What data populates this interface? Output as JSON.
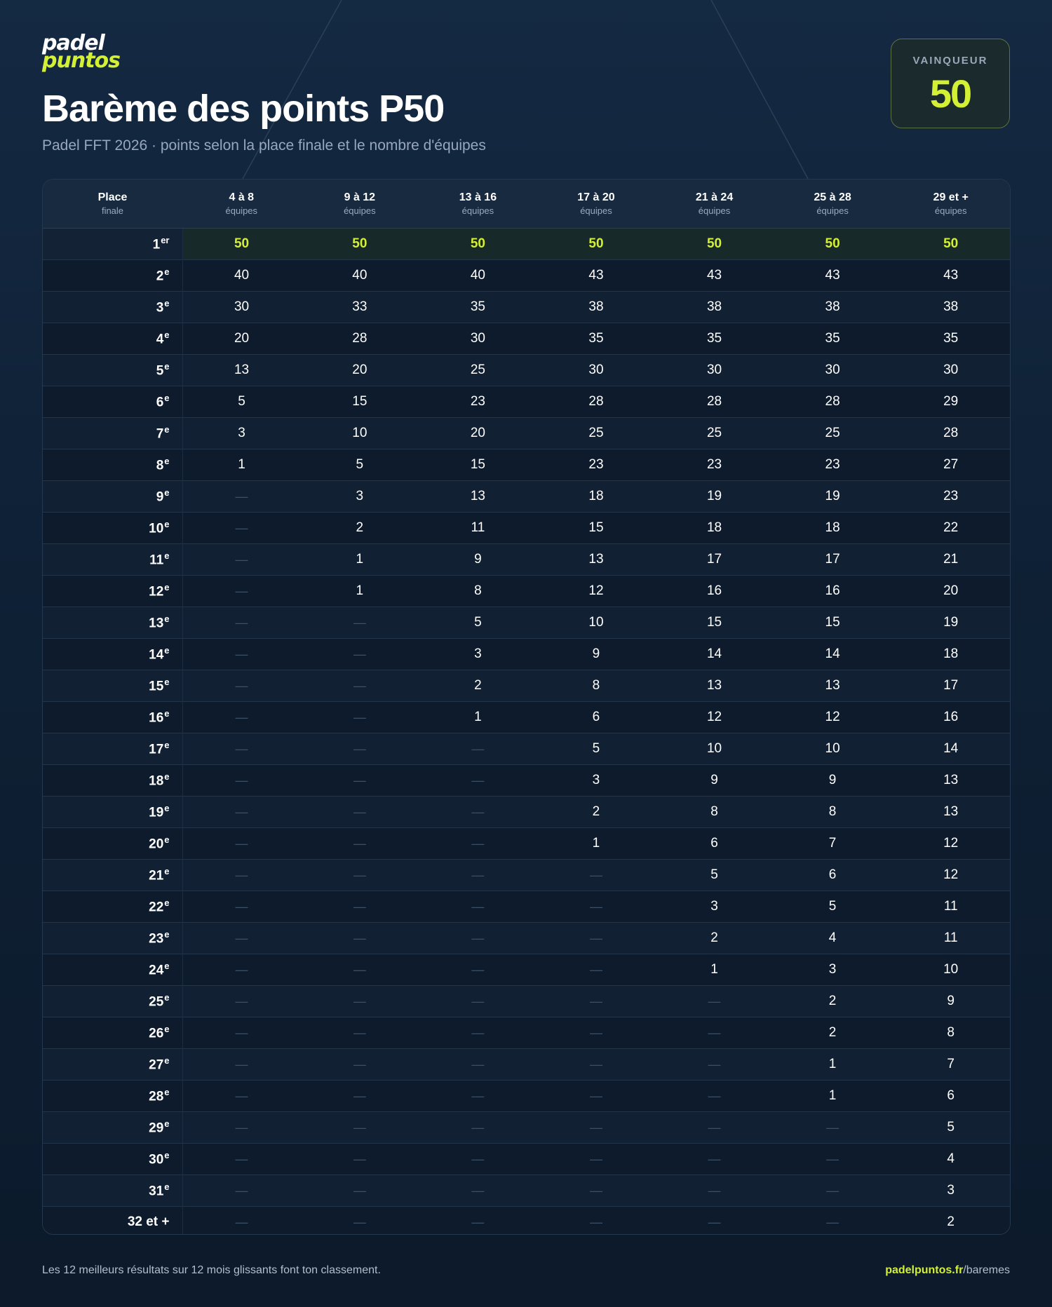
{
  "brand": {
    "line1": "padel",
    "line2": "puntos",
    "accent_color": "#d4f034"
  },
  "title": "Barème des points P50",
  "subtitle": "Padel FFT 2026 · points selon la place finale et le nombre d'équipes",
  "winner": {
    "label": "VAINQUEUR",
    "value": "50"
  },
  "table": {
    "place_header": {
      "line1": "Place",
      "line2": "finale"
    },
    "columns": [
      {
        "line1": "4 à 8",
        "line2": "équipes"
      },
      {
        "line1": "9 à 12",
        "line2": "équipes"
      },
      {
        "line1": "13 à 16",
        "line2": "équipes"
      },
      {
        "line1": "17 à 20",
        "line2": "équipes"
      },
      {
        "line1": "21 à 24",
        "line2": "équipes"
      },
      {
        "line1": "25 à 28",
        "line2": "équipes"
      },
      {
        "line1": "29 et +",
        "line2": "équipes"
      }
    ],
    "rows": [
      {
        "place": "1",
        "suffix": "er",
        "values": [
          "50",
          "50",
          "50",
          "50",
          "50",
          "50",
          "50"
        ]
      },
      {
        "place": "2",
        "suffix": "e",
        "values": [
          "40",
          "40",
          "40",
          "43",
          "43",
          "43",
          "43"
        ]
      },
      {
        "place": "3",
        "suffix": "e",
        "values": [
          "30",
          "33",
          "35",
          "38",
          "38",
          "38",
          "38"
        ]
      },
      {
        "place": "4",
        "suffix": "e",
        "values": [
          "20",
          "28",
          "30",
          "35",
          "35",
          "35",
          "35"
        ]
      },
      {
        "place": "5",
        "suffix": "e",
        "values": [
          "13",
          "20",
          "25",
          "30",
          "30",
          "30",
          "30"
        ]
      },
      {
        "place": "6",
        "suffix": "e",
        "values": [
          "5",
          "15",
          "23",
          "28",
          "28",
          "28",
          "29"
        ]
      },
      {
        "place": "7",
        "suffix": "e",
        "values": [
          "3",
          "10",
          "20",
          "25",
          "25",
          "25",
          "28"
        ]
      },
      {
        "place": "8",
        "suffix": "e",
        "values": [
          "1",
          "5",
          "15",
          "23",
          "23",
          "23",
          "27"
        ]
      },
      {
        "place": "9",
        "suffix": "e",
        "values": [
          "—",
          "3",
          "13",
          "18",
          "19",
          "19",
          "23"
        ]
      },
      {
        "place": "10",
        "suffix": "e",
        "values": [
          "—",
          "2",
          "11",
          "15",
          "18",
          "18",
          "22"
        ]
      },
      {
        "place": "11",
        "suffix": "e",
        "values": [
          "—",
          "1",
          "9",
          "13",
          "17",
          "17",
          "21"
        ]
      },
      {
        "place": "12",
        "suffix": "e",
        "values": [
          "—",
          "1",
          "8",
          "12",
          "16",
          "16",
          "20"
        ]
      },
      {
        "place": "13",
        "suffix": "e",
        "values": [
          "—",
          "—",
          "5",
          "10",
          "15",
          "15",
          "19"
        ]
      },
      {
        "place": "14",
        "suffix": "e",
        "values": [
          "—",
          "—",
          "3",
          "9",
          "14",
          "14",
          "18"
        ]
      },
      {
        "place": "15",
        "suffix": "e",
        "values": [
          "—",
          "—",
          "2",
          "8",
          "13",
          "13",
          "17"
        ]
      },
      {
        "place": "16",
        "suffix": "e",
        "values": [
          "—",
          "—",
          "1",
          "6",
          "12",
          "12",
          "16"
        ]
      },
      {
        "place": "17",
        "suffix": "e",
        "values": [
          "—",
          "—",
          "—",
          "5",
          "10",
          "10",
          "14"
        ]
      },
      {
        "place": "18",
        "suffix": "e",
        "values": [
          "—",
          "—",
          "—",
          "3",
          "9",
          "9",
          "13"
        ]
      },
      {
        "place": "19",
        "suffix": "e",
        "values": [
          "—",
          "—",
          "—",
          "2",
          "8",
          "8",
          "13"
        ]
      },
      {
        "place": "20",
        "suffix": "e",
        "values": [
          "—",
          "—",
          "—",
          "1",
          "6",
          "7",
          "12"
        ]
      },
      {
        "place": "21",
        "suffix": "e",
        "values": [
          "—",
          "—",
          "—",
          "—",
          "5",
          "6",
          "12"
        ]
      },
      {
        "place": "22",
        "suffix": "e",
        "values": [
          "—",
          "—",
          "—",
          "—",
          "3",
          "5",
          "11"
        ]
      },
      {
        "place": "23",
        "suffix": "e",
        "values": [
          "—",
          "—",
          "—",
          "—",
          "2",
          "4",
          "11"
        ]
      },
      {
        "place": "24",
        "suffix": "e",
        "values": [
          "—",
          "—",
          "—",
          "—",
          "1",
          "3",
          "10"
        ]
      },
      {
        "place": "25",
        "suffix": "e",
        "values": [
          "—",
          "—",
          "—",
          "—",
          "—",
          "2",
          "9"
        ]
      },
      {
        "place": "26",
        "suffix": "e",
        "values": [
          "—",
          "—",
          "—",
          "—",
          "—",
          "2",
          "8"
        ]
      },
      {
        "place": "27",
        "suffix": "e",
        "values": [
          "—",
          "—",
          "—",
          "—",
          "—",
          "1",
          "7"
        ]
      },
      {
        "place": "28",
        "suffix": "e",
        "values": [
          "—",
          "—",
          "—",
          "—",
          "—",
          "1",
          "6"
        ]
      },
      {
        "place": "29",
        "suffix": "e",
        "values": [
          "—",
          "—",
          "—",
          "—",
          "—",
          "—",
          "5"
        ]
      },
      {
        "place": "30",
        "suffix": "e",
        "values": [
          "—",
          "—",
          "—",
          "—",
          "—",
          "—",
          "4"
        ]
      },
      {
        "place": "31",
        "suffix": "e",
        "values": [
          "—",
          "—",
          "—",
          "—",
          "—",
          "—",
          "3"
        ]
      },
      {
        "place": "32 et +",
        "suffix": "",
        "values": [
          "—",
          "—",
          "—",
          "—",
          "—",
          "—",
          "2"
        ]
      }
    ]
  },
  "footer": {
    "note": "Les 12 meilleurs résultats sur 12 mois glissants font ton classement.",
    "link_domain": "padelpuntos.fr",
    "link_path": "/baremes"
  }
}
